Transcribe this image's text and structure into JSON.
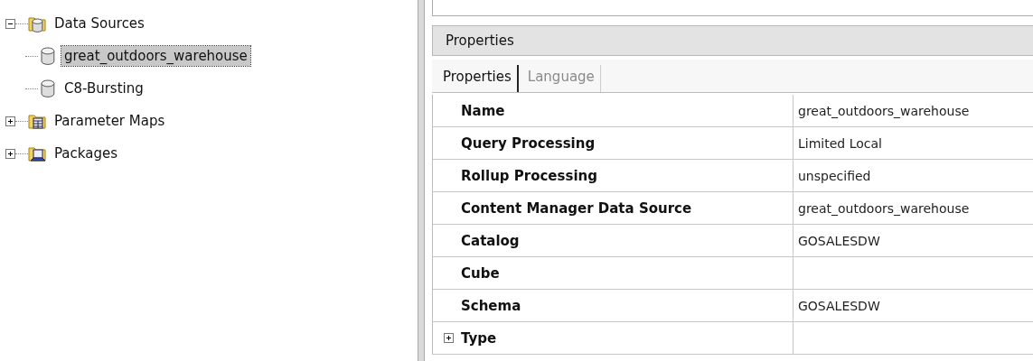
{
  "tree": [
    {
      "label": "Data Sources",
      "kind": "database-folder",
      "expanded": true,
      "selected": false,
      "children": [
        {
          "label": "great_outdoors_warehouse",
          "kind": "database",
          "selected": true
        },
        {
          "label": "C8-Bursting",
          "kind": "database",
          "selected": false
        }
      ]
    },
    {
      "label": "Parameter Maps",
      "kind": "table-folder",
      "expanded": false,
      "selected": false
    },
    {
      "label": "Packages",
      "kind": "package-folder",
      "expanded": false,
      "selected": false
    }
  ],
  "properties_panel": {
    "title": "Properties",
    "tabs": [
      {
        "label": "Properties",
        "selected": true
      },
      {
        "label": "Language",
        "selected": false
      }
    ],
    "rows": [
      {
        "name": "Name",
        "value": "great_outdoors_warehouse"
      },
      {
        "name": "Query Processing",
        "value": "Limited Local"
      },
      {
        "name": "Rollup Processing",
        "value": "unspecified"
      },
      {
        "name": "Content Manager Data Source",
        "value": "great_outdoors_warehouse"
      },
      {
        "name": "Catalog",
        "value": "GOSALESDW"
      },
      {
        "name": "Cube"
      },
      {
        "name": "Schema",
        "value": "GOSALESDW"
      },
      {
        "name": "Type",
        "expanded": false
      }
    ]
  }
}
